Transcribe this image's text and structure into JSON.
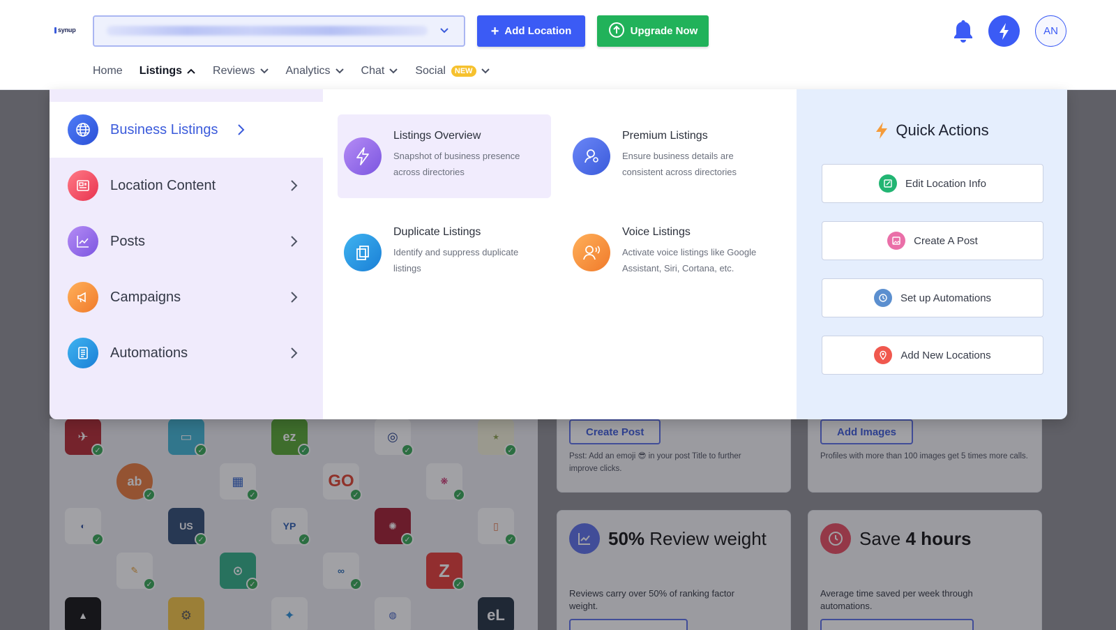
{
  "app": {
    "logo_text": "synup"
  },
  "header": {
    "add_location_label": "Add Location",
    "upgrade_label": "Upgrade Now",
    "avatar_initials": "AN"
  },
  "nav": {
    "items": [
      {
        "label": "Home"
      },
      {
        "label": "Listings"
      },
      {
        "label": "Reviews"
      },
      {
        "label": "Analytics"
      },
      {
        "label": "Chat"
      },
      {
        "label": "Social",
        "badge": "NEW"
      }
    ]
  },
  "menu": {
    "side": [
      {
        "label": "Business Listings",
        "icon": "globe-icon"
      },
      {
        "label": "Location Content",
        "icon": "newspaper-icon"
      },
      {
        "label": "Posts",
        "icon": "chart-line-icon"
      },
      {
        "label": "Campaigns",
        "icon": "megaphone-icon"
      },
      {
        "label": "Automations",
        "icon": "document-icon"
      }
    ],
    "sub": [
      {
        "title": "Listings Overview",
        "desc": "Snapshot of business presence across directories",
        "icon": "bolt-icon"
      },
      {
        "title": "Premium Listings",
        "desc": "Ensure business details are consistent across directories",
        "icon": "person-pin-icon"
      },
      {
        "title": "Duplicate Listings",
        "desc": "Identify and suppress duplicate listings",
        "icon": "copy-icon"
      },
      {
        "title": "Voice Listings",
        "desc": "Activate voice listings like Google Assistant, Siri, Cortana, etc.",
        "icon": "voice-user-icon"
      }
    ],
    "quick_actions": {
      "title": "Quick Actions",
      "items": [
        {
          "label": "Edit Location Info",
          "icon": "edit-icon"
        },
        {
          "label": "Create A Post",
          "icon": "image-icon"
        },
        {
          "label": "Set up Automations",
          "icon": "clock-icon"
        },
        {
          "label": "Add New Locations",
          "icon": "location-pin-icon"
        }
      ]
    }
  },
  "background": {
    "card_post": {
      "button": "Create Post",
      "tip": "Psst: Add an emoji 😎 in your post Title to further improve clicks."
    },
    "card_images": {
      "button": "Add Images",
      "tip": "Profiles with more than 100 images get 5 times more calls."
    },
    "stat_review": {
      "value": "50%",
      "label": "Review weight",
      "text": "Reviews carry over 50% of ranking factor weight."
    },
    "stat_save": {
      "prefix": "Save",
      "value": "4 hours",
      "text": "Average time saved per week through automations."
    },
    "directory_logos": [
      "ez",
      "ab",
      "GO",
      "Z",
      "eL"
    ]
  },
  "colors": {
    "primary": "#3b5bf5",
    "success": "#21b25a",
    "menu_side_bg": "#f0ebfc",
    "quick_actions_bg": "#e5eefd"
  }
}
